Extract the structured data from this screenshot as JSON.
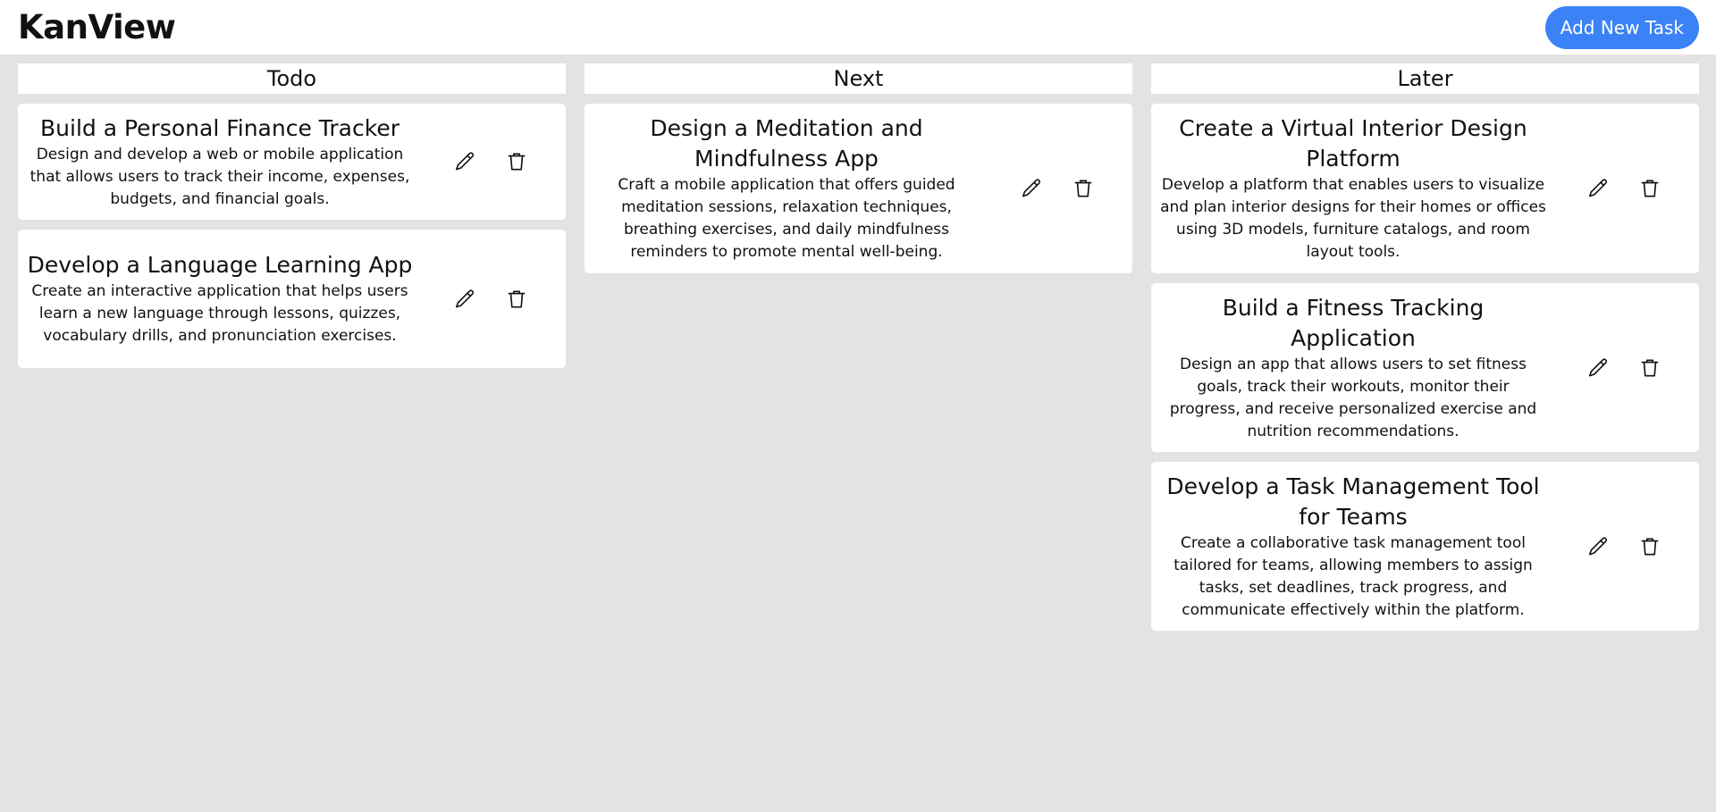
{
  "header": {
    "title": "KanView",
    "add_button_label": "Add New Task"
  },
  "colors": {
    "background": "#e4e3e2",
    "card": "#ffffff",
    "accent": "#3b82f6"
  },
  "icons": {
    "edit": "pencil-icon",
    "delete": "trash-icon"
  },
  "columns": [
    {
      "title": "Todo",
      "tasks": [
        {
          "title": "Build a Personal Finance Tracker",
          "description": "Design and develop a web or mobile application that allows users to track their income, expenses, budgets, and financial goals."
        },
        {
          "title": "Develop a Language Learning App",
          "description": "Create an interactive application that helps users learn a new language through lessons, quizzes, vocabulary drills, and pronunciation exercises."
        }
      ]
    },
    {
      "title": "Next",
      "tasks": [
        {
          "title": "Design a Meditation and Mindfulness App",
          "description": "Craft a mobile application that offers guided meditation sessions, relaxation techniques, breathing exercises, and daily mindfulness reminders to promote mental well-being."
        }
      ]
    },
    {
      "title": "Later",
      "tasks": [
        {
          "title": "Create a Virtual Interior Design Platform",
          "description": "Develop a platform that enables users to visualize and plan interior designs for their homes or offices using 3D models, furniture catalogs, and room layout tools."
        },
        {
          "title": "Build a Fitness Tracking Application",
          "description": "Design an app that allows users to set fitness goals, track their workouts, monitor their progress, and receive personalized exercise and nutrition recommendations."
        },
        {
          "title": "Develop a Task Management Tool for Teams",
          "description": "Create a collaborative task management tool tailored for teams, allowing members to assign tasks, set deadlines, track progress, and communicate effectively within the platform."
        }
      ]
    }
  ]
}
